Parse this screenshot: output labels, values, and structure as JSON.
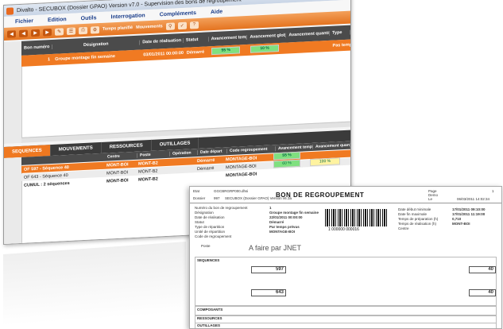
{
  "window": {
    "title": "Divalto - SECUBOX (Dossier GPAO) Version v7.0 - Supervision des bons de regroupement -",
    "menu": [
      "Fichier",
      "Edition",
      "Outils",
      "Interrogation",
      "Compléments",
      "Aide"
    ],
    "toolbar_labels": [
      "Temps planifié",
      "Mouvements"
    ]
  },
  "main_grid": {
    "headers": [
      "Bon numéro",
      "Désignation",
      "Date de réalisation",
      "Statut",
      "Avancement temps",
      "Avancement global",
      "Avancement quantité",
      "Type"
    ],
    "rows": [
      {
        "num": "1",
        "designation": "Groupe montage fin semaine",
        "date": "03/01/2011 00:00:00",
        "statut": "Démarré",
        "av_temps": "55 %",
        "av_global": "10 %",
        "av_qte": "",
        "type": "Pas temps"
      }
    ],
    "colors": {
      "header": "#4b4b4b",
      "selected": "#f07a22",
      "progress": "#7fe07f"
    }
  },
  "tabs": [
    "SEQUENCES",
    "MOUVEMENTS",
    "RESSOURCES",
    "OUTILLAGES"
  ],
  "sub_grid": {
    "headers": [
      "",
      "Centre",
      "Poste",
      "Opération",
      "Date départ",
      "Code regroupement",
      "Avancement temps",
      "Avancement quantité"
    ],
    "rows": [
      {
        "label": "OF 597 - Séquence 40",
        "centre": "MONT-BOI",
        "poste": "MONT-B2",
        "operation": "",
        "statut": "Démarré",
        "code": "MONTAGE-BOI",
        "t": "55 %",
        "q": ""
      },
      {
        "label": "OF 643 - Séquence 40",
        "centre": "MONT-BOI",
        "poste": "MONT-B2",
        "operation": "",
        "statut": "Démarré",
        "code": "MONTAGE-BOI",
        "t": "60 %",
        "q": "100 %"
      },
      {
        "label": "CUMUL : 2 séquences",
        "centre": "MONT-BOI",
        "poste": "MONT-B2",
        "operation": "",
        "statut": "",
        "code": "MONTAGE-BOI",
        "t": "",
        "q": ""
      }
    ]
  },
  "report": {
    "etat": "Etat",
    "etat_code": "GGCBRGRP000.dhsi",
    "dossier": "Dossier",
    "dossier_num": "997",
    "dossier_name": "SECUBOX (Dossier GPAO) Version v6.3a",
    "title": "BON DE REGROUPEMENT",
    "page_label": "Page",
    "page_num": "1",
    "demo": "Demo",
    "le_label": "Le",
    "le_value": "06/03/2011 14:02:34",
    "left_fields": [
      "Numéro du bon de regroupement",
      "Désignation",
      "Date de réalisation",
      "Statut",
      "Type de répartition",
      "Unité de répartition",
      "Code de regroupement"
    ],
    "left_values": [
      "1",
      "Groupe montage fin semaine",
      "22/01/2011 00:00:00",
      "Démarré",
      "Par temps prévus",
      "",
      "MONTAGE-BOI"
    ],
    "barcode_text": "1  000000  000016",
    "right_fields": [
      "Date début minimale",
      "Date fin maximale",
      "Temps de préparation (h)",
      "Temps de réalisation (h)",
      "Centre"
    ],
    "right_values": [
      "17/01/2011 09:10:00",
      "17/01/2011 11:19:00",
      "",
      "0,710",
      "MONT-BOI"
    ],
    "poste_label": "Poste",
    "watermark": "A faire par JNET",
    "sequences_title": "SEQUENCES",
    "of1": "597",
    "of2": "643",
    "seq1": "40",
    "seq2": "40",
    "composants_title": "COMPOSANTS",
    "ressources_title": "RESSOURCES",
    "outillages_title": "OUTILLAGES"
  }
}
